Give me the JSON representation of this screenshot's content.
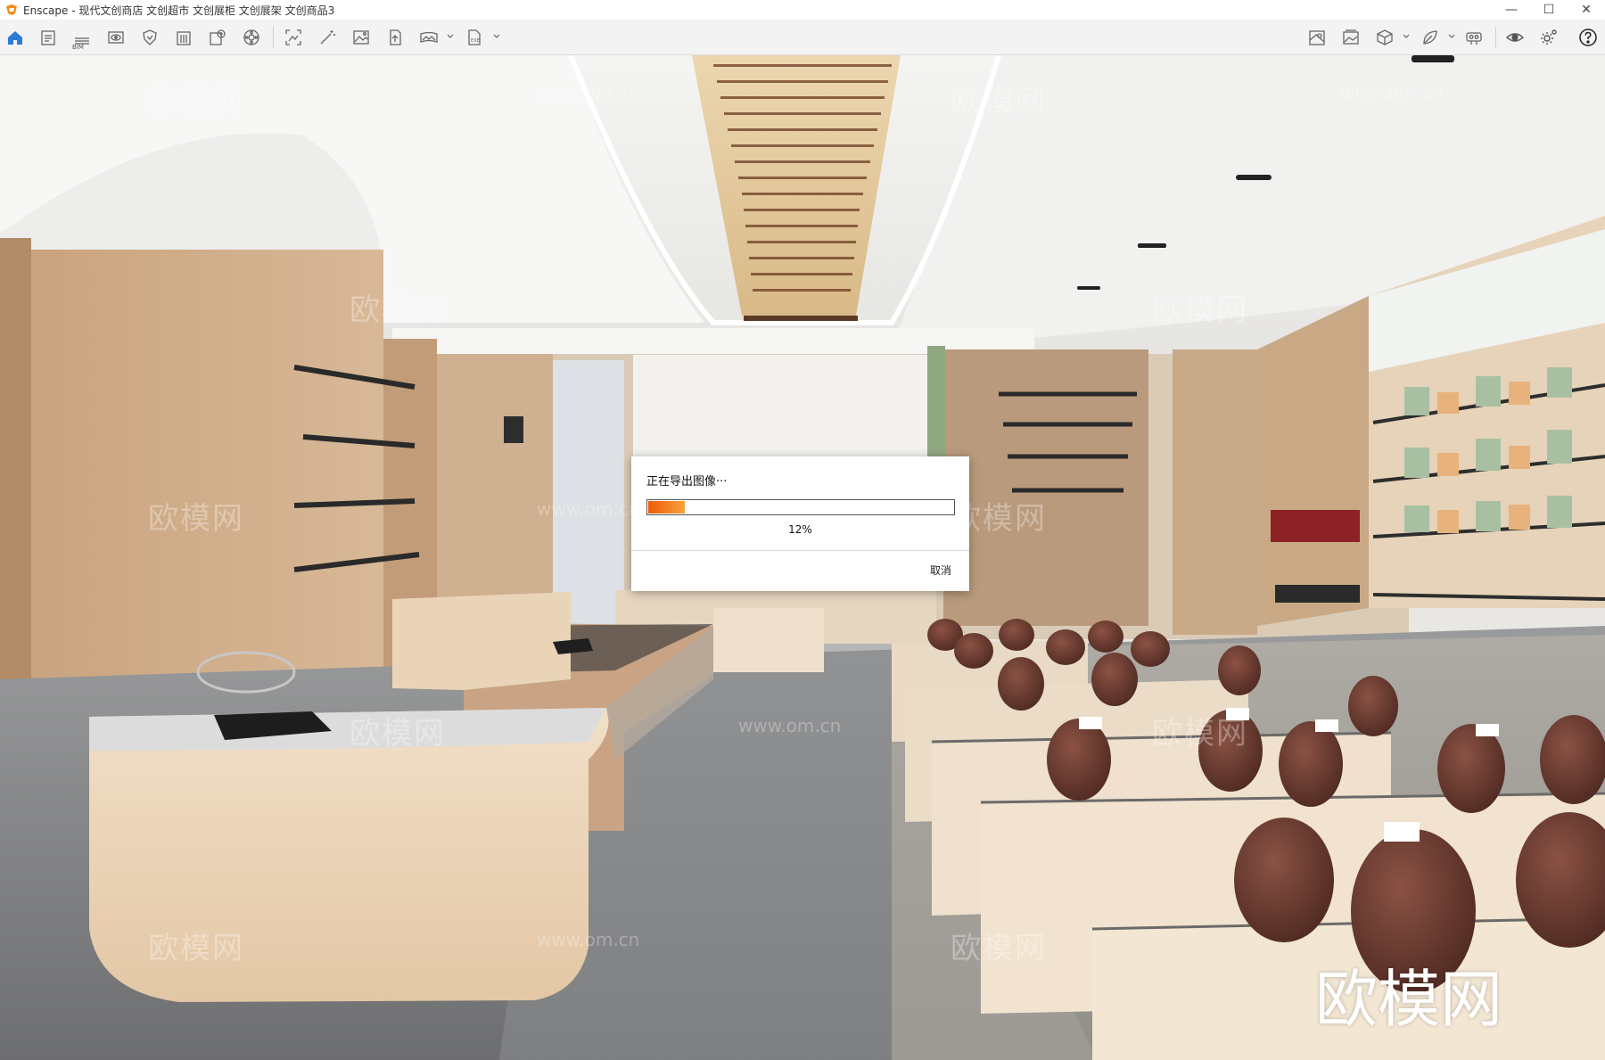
{
  "window": {
    "title": "Enscape - 现代文创商店 文创超市 文创展柜 文创展架 文创商品3",
    "controls": {
      "minimize": "—",
      "maximize": "☐",
      "close": "✕"
    }
  },
  "toolbar": {
    "bim_label": "BIM",
    "left_icons": [
      "home-icon",
      "document-icon",
      "bim-list-icon",
      "view-icon",
      "shield-icon",
      "building-icon",
      "asset-library-icon",
      "settings-wheel-icon",
      "screenshot-icon",
      "magic-wand-icon",
      "image-icon",
      "upload-icon",
      "panorama-icon",
      "export-icon"
    ],
    "right_icons": [
      "map-icon",
      "gallery-icon",
      "cube-icon",
      "leaf-icon",
      "vr-headset-icon",
      "eye-icon",
      "gear-icon",
      "help-icon"
    ]
  },
  "viewport": {
    "watermark_text": "欧模网",
    "watermark_url": "www.om.cn",
    "watermark_big": "欧模网"
  },
  "dialog": {
    "message": "正在导出图像···",
    "progress": 0.12,
    "percent_label": "12%",
    "cancel_label": "取消"
  },
  "colors": {
    "accent": "#2b7bd8",
    "progress_start": "#f05a0c",
    "progress_end": "#f7a23a",
    "logo": "#f28c1c"
  }
}
